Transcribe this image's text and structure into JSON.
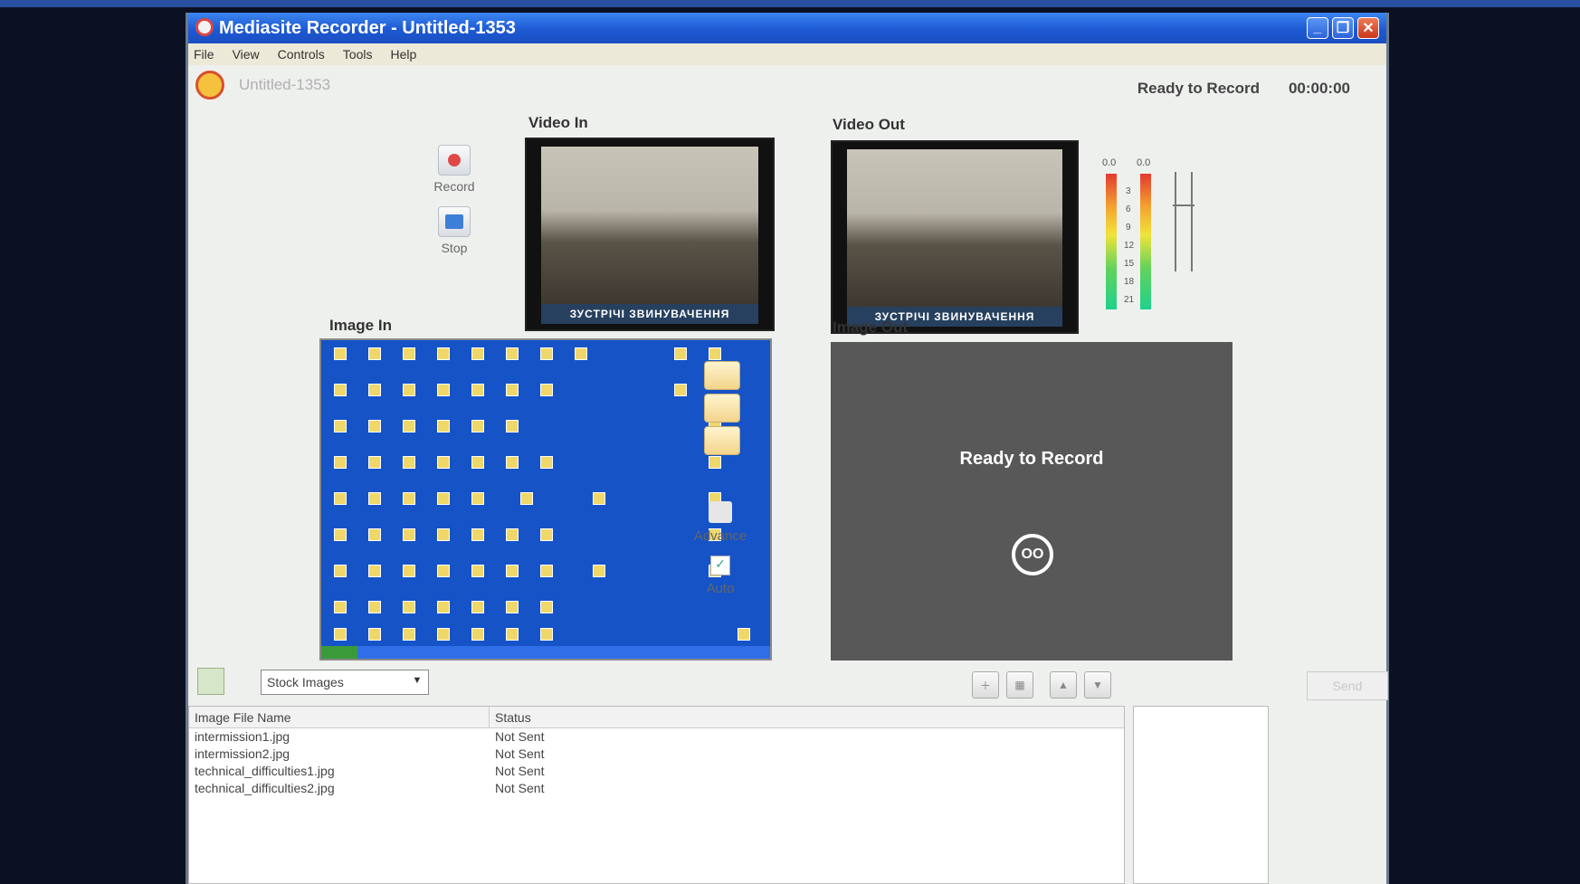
{
  "window": {
    "title": "Mediasite Recorder - Untitled-1353"
  },
  "menu": [
    "File",
    "View",
    "Controls",
    "Tools",
    "Help"
  ],
  "doc": {
    "title": "Untitled-1353",
    "status": "Ready to Record",
    "timer": "00:00:00"
  },
  "transport": {
    "record_label": "Record",
    "stop_label": "Stop"
  },
  "sections": {
    "video_in": "Video In",
    "video_out": "Video Out",
    "image_in": "Image In",
    "image_out": "Image Out"
  },
  "video": {
    "caption": "ЗУСТРІЧІ ЗВИНУВАЧЕННЯ"
  },
  "meters": {
    "left_value": "0.0",
    "right_value": "0.0",
    "ticks": [
      "3",
      "6",
      "9",
      "12",
      "15",
      "18",
      "21"
    ]
  },
  "image_out": {
    "message": "Ready to Record",
    "logo_text": "OO"
  },
  "controls": {
    "advance_label": "Advance",
    "auto_label": "Auto",
    "auto_checked": true
  },
  "images_source": {
    "selected": "Stock Images"
  },
  "send_label": "Send",
  "table": {
    "headers": [
      "Image File Name",
      "Status"
    ],
    "rows": [
      [
        "intermission1.jpg",
        "Not Sent"
      ],
      [
        "intermission2.jpg",
        "Not Sent"
      ],
      [
        "technical_difficulties1.jpg",
        "Not Sent"
      ],
      [
        "technical_difficulties2.jpg",
        "Not Sent"
      ]
    ]
  }
}
